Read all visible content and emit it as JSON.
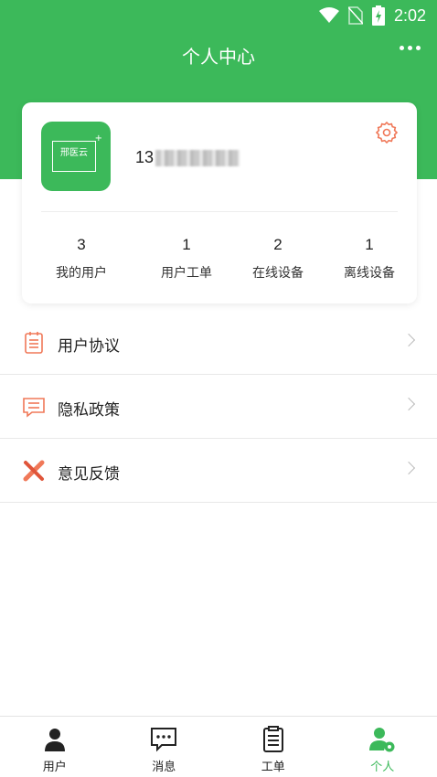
{
  "status_bar": {
    "time": "2:02"
  },
  "header": {
    "title": "个人中心"
  },
  "profile": {
    "logo_text": "邢医云",
    "phone_prefix": "13"
  },
  "stats": [
    {
      "value": "3",
      "label": "我的用户"
    },
    {
      "value": "1",
      "label": "用户工单"
    },
    {
      "value": "2",
      "label": "在线设备"
    },
    {
      "value": "1",
      "label": "离线设备"
    }
  ],
  "menu": [
    {
      "label": "用户协议",
      "icon": "clipboard-icon"
    },
    {
      "label": "隐私政策",
      "icon": "message-square-icon"
    },
    {
      "label": "意见反馈",
      "icon": "tools-icon"
    }
  ],
  "tabs": [
    {
      "label": "用户",
      "icon": "person-icon"
    },
    {
      "label": "消息",
      "icon": "chat-icon"
    },
    {
      "label": "工单",
      "icon": "document-icon"
    },
    {
      "label": "个人",
      "icon": "person-gear-icon"
    }
  ],
  "colors": {
    "brand": "#3cb95a",
    "accent": "#f07858"
  }
}
